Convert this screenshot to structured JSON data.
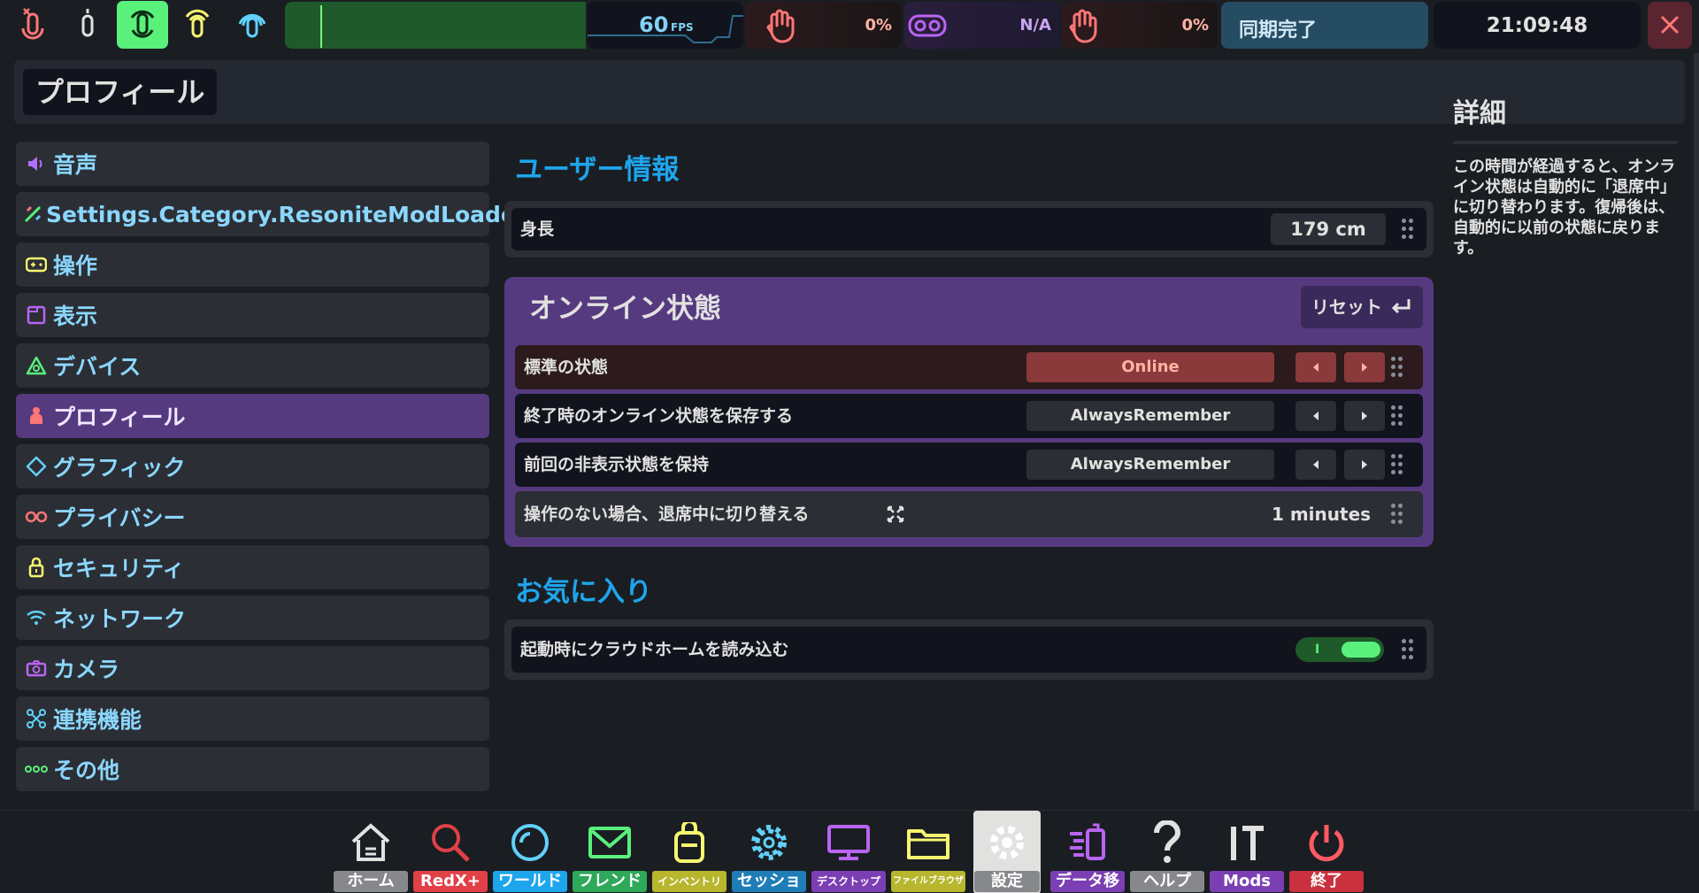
{
  "topbar": {
    "mic_icons": [
      "mic-muted-icon",
      "mic-push-to-talk-icon",
      "mic-active-icon",
      "mic-broadcast-icon",
      "mic-spatial-icon"
    ],
    "fps_value": "60",
    "fps_unit": "FPS",
    "left_hand_percent": "0%",
    "vr_status": "N/A",
    "right_hand_percent": "0%",
    "sync_status": "同期完了",
    "clock": "21:09:48",
    "colors": {
      "mic_active": "#59f07b",
      "sync_bg": "#264c63",
      "accent_blue": "#1ea5ec",
      "purple": "#563a80"
    }
  },
  "header": {
    "title": "プロフィール"
  },
  "sidebar": {
    "items": [
      {
        "label": "音声",
        "icon": "speaker-icon",
        "color": "#b070ff"
      },
      {
        "label": "Settings.Category.ResoniteModLoader",
        "icon": "mod-loader-icon",
        "color": "#59f07b"
      },
      {
        "label": "操作",
        "icon": "gamepad-icon",
        "color": "#f8f770"
      },
      {
        "label": "表示",
        "icon": "window-icon",
        "color": "#ba64f2"
      },
      {
        "label": "デバイス",
        "icon": "device-icon",
        "color": "#59f07b"
      },
      {
        "label": "プロフィール",
        "icon": "user-icon",
        "color": "#ff7676",
        "active": true
      },
      {
        "label": "グラフィック",
        "icon": "diamond-icon",
        "color": "#61d1fa"
      },
      {
        "label": "プライバシー",
        "icon": "glasses-icon",
        "color": "#ff7676"
      },
      {
        "label": "セキュリティ",
        "icon": "lock-icon",
        "color": "#f8f770"
      },
      {
        "label": "ネットワーク",
        "icon": "wifi-icon",
        "color": "#61d1fa"
      },
      {
        "label": "カメラ",
        "icon": "camera-icon",
        "color": "#ba64f2"
      },
      {
        "label": "連携機能",
        "icon": "integration-icon",
        "color": "#61d1fa"
      },
      {
        "label": "その他",
        "icon": "more-icon",
        "color": "#59f07b"
      }
    ]
  },
  "main": {
    "user_info": {
      "heading": "ユーザー情報",
      "height_label": "身長",
      "height_value": "179 cm"
    },
    "online_status": {
      "heading": "オンライン状態",
      "reset_label": "リセット",
      "rows": [
        {
          "label": "標準の状態",
          "value": "Online"
        },
        {
          "label": "終了時のオンライン状態を保存する",
          "value": "AlwaysRemember"
        },
        {
          "label": "前回の非表示状態を保持",
          "value": "AlwaysRemember"
        }
      ],
      "idle_label": "操作のない場合、退席中に切り替える",
      "idle_value": "1 minutes"
    },
    "favorites": {
      "heading": "お気に入り",
      "cloud_home_label": "起動時にクラウドホームを読み込む",
      "cloud_home_toggle_text": "I",
      "cloud_home_on": true
    }
  },
  "detail": {
    "heading": "詳細",
    "text": "この時間が経過すると、オンライン状態は自動的に「退席中」に切り替わります。復帰後は、自動的に以前の状態に戻ります。"
  },
  "dock": {
    "items": [
      {
        "label": "ホーム",
        "icon": "home-icon",
        "color": "#86888b"
      },
      {
        "label": "RedX+",
        "icon": "magnifier-icon",
        "color": "#e14047"
      },
      {
        "label": "ワールド",
        "icon": "world-icon",
        "color": "#1ea5ec"
      },
      {
        "label": "フレンド",
        "icon": "mail-icon",
        "color": "#2fa85a"
      },
      {
        "label": "インベントリ",
        "icon": "backpack-icon",
        "color": "#b7b62d"
      },
      {
        "label": "セッション",
        "icon": "gear-icon",
        "color": "#1f7db8"
      },
      {
        "label": "デスクトップ",
        "icon": "monitor-icon",
        "color": "#7b3fb3"
      },
      {
        "label": "ファイルブラウザ",
        "icon": "folder-icon",
        "color": "#b7b62d"
      },
      {
        "label": "設定",
        "icon": "settings-icon",
        "color": "#86888b",
        "selected": true
      },
      {
        "label": "データ移行",
        "icon": "data-migration-icon",
        "color": "#7b3fb3"
      },
      {
        "label": "ヘルプ",
        "icon": "question-icon",
        "color": "#86888b"
      },
      {
        "label": "Mods",
        "icon": "tools-icon",
        "color": "#7b3fb3"
      },
      {
        "label": "終了",
        "icon": "power-icon",
        "color": "#c8313d"
      }
    ]
  }
}
